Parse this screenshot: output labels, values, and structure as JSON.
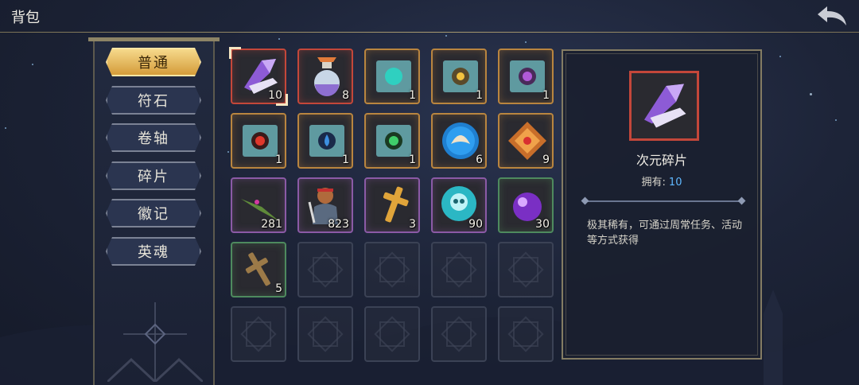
{
  "header": {
    "title": "背包",
    "back_icon": "back-arrow-icon"
  },
  "tabs": [
    {
      "label": "普通",
      "active": true
    },
    {
      "label": "符石",
      "active": false
    },
    {
      "label": "卷轴",
      "active": false
    },
    {
      "label": "碎片",
      "active": false
    },
    {
      "label": "徽记",
      "active": false
    },
    {
      "label": "英魂",
      "active": false
    }
  ],
  "inventory": [
    {
      "icon": "crystal-shard-icon",
      "quantity": "10",
      "rarity": "red",
      "selected": true
    },
    {
      "icon": "potion-flask-icon",
      "quantity": "8",
      "rarity": "red"
    },
    {
      "icon": "teal-rune-scroll-icon",
      "quantity": "1",
      "rarity": "orange"
    },
    {
      "icon": "sun-rune-scroll-icon",
      "quantity": "1",
      "rarity": "orange"
    },
    {
      "icon": "purple-rune-scroll-icon",
      "quantity": "1",
      "rarity": "orange"
    },
    {
      "icon": "fire-rune-scroll-icon",
      "quantity": "1",
      "rarity": "orange"
    },
    {
      "icon": "water-rune-scroll-icon",
      "quantity": "1",
      "rarity": "orange"
    },
    {
      "icon": "leaf-rune-scroll-icon",
      "quantity": "1",
      "rarity": "orange"
    },
    {
      "icon": "blue-wing-badge-icon",
      "quantity": "6",
      "rarity": "orange"
    },
    {
      "icon": "bronze-cross-emblem-icon",
      "quantity": "9",
      "rarity": "orange"
    },
    {
      "icon": "green-leaf-blade-icon",
      "quantity": "281",
      "rarity": "purple"
    },
    {
      "icon": "hero-warrior-icon",
      "quantity": "823",
      "rarity": "purple"
    },
    {
      "icon": "golden-cross-icon",
      "quantity": "3",
      "rarity": "purple"
    },
    {
      "icon": "skull-badge-icon",
      "quantity": "90",
      "rarity": "purple"
    },
    {
      "icon": "purple-orb-icon",
      "quantity": "30",
      "rarity": "green"
    },
    {
      "icon": "wooden-cross-icon",
      "quantity": "5",
      "rarity": "green"
    }
  ],
  "detail": {
    "icon": "crystal-shard-icon",
    "name": "次元碎片",
    "owned_label": "拥有:",
    "owned_value": "10",
    "description": "极其稀有，可通过周常任务、活动等方式获得"
  },
  "colors": {
    "rarity_red": "#c4473a",
    "rarity_orange": "#b9853f",
    "rarity_purple": "#8b5aa6",
    "rarity_green": "#4e8a5e",
    "active_tab": "#e3b55a",
    "owned_value": "#5fb8ff"
  }
}
